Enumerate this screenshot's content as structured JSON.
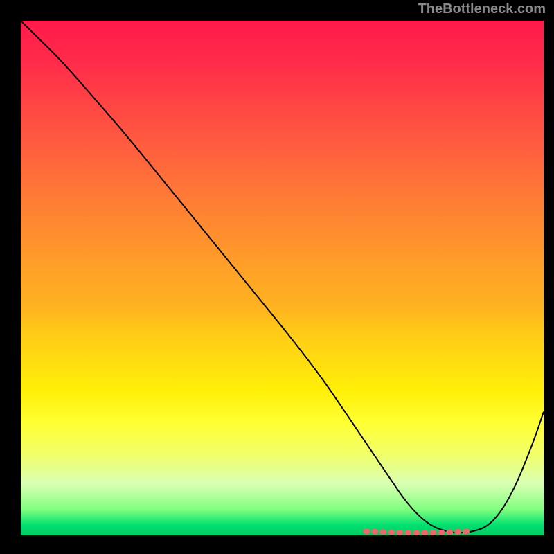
{
  "watermark": "TheBottleneck.com",
  "chart_data": {
    "type": "line",
    "title": "",
    "xlabel": "",
    "ylabel": "",
    "xlim": [
      0,
      100
    ],
    "ylim": [
      0,
      100
    ],
    "grid": false,
    "series": [
      {
        "name": "curve",
        "x": [
          0,
          3,
          8,
          14,
          20,
          28,
          36,
          44,
          52,
          58,
          62,
          66,
          70,
          74,
          78,
          82,
          86,
          90,
          94,
          98,
          100
        ],
        "y": [
          100,
          97,
          92,
          85,
          78,
          68,
          58,
          48,
          38,
          30,
          24,
          18,
          12,
          6,
          2,
          0.5,
          0.5,
          2,
          8,
          18,
          24
        ]
      }
    ],
    "markers": {
      "name": "optimal-range",
      "x": [
        66,
        70,
        74,
        78,
        82,
        86
      ],
      "y": [
        0.8,
        0.6,
        0.5,
        0.5,
        0.6,
        0.8
      ]
    },
    "gradient": {
      "top_color": "#ff1a4a",
      "mid_color": "#ffff33",
      "bottom_color": "#00cc66"
    }
  }
}
